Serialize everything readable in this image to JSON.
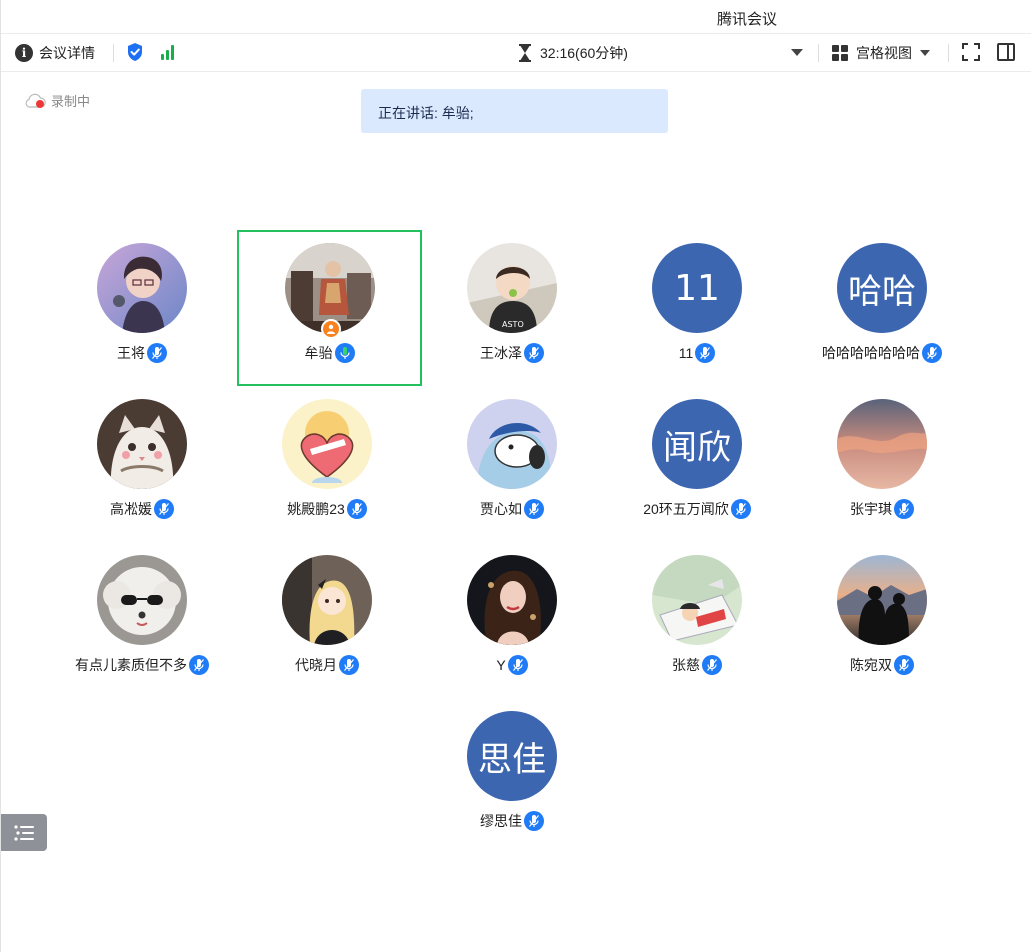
{
  "window": {
    "title": "腾讯会议"
  },
  "toolbar": {
    "meeting_info_label": "会议详情",
    "timer_text": "32:16(60分钟)",
    "view_label": "宫格视图"
  },
  "recording_label": "录制中",
  "speaking_banner": "正在讲话: 牟骀;",
  "colors": {
    "accent": "#3d66b1",
    "active_border": "#22c15e",
    "mic": "#1f7bf6",
    "banner": "#dbe9ff"
  },
  "participants": [
    {
      "name": "王将",
      "avatar": "photo-anime-boy",
      "muted": true
    },
    {
      "name": "牟骀",
      "avatar": "photo-child-old",
      "speaking": true,
      "host": true
    },
    {
      "name": "王冰泽",
      "avatar": "photo-baby",
      "muted": true
    },
    {
      "name": "11",
      "avatar_text": "11",
      "muted": true
    },
    {
      "name": "哈哈哈哈哈哈哈",
      "avatar_text": "哈哈",
      "muted": true
    },
    {
      "name": "高凇媛",
      "avatar": "photo-cat",
      "muted": true
    },
    {
      "name": "姚殿鹏23",
      "avatar": "photo-heart-cartoon",
      "muted": true
    },
    {
      "name": "贾心如",
      "avatar": "photo-puppy-cartoon",
      "muted": true
    },
    {
      "name": "20环五万闻欣",
      "avatar_text": "闻欣",
      "muted": true
    },
    {
      "name": "张宇琪",
      "avatar": "photo-sunset-sky",
      "muted": true
    },
    {
      "name": "有点儿素质但不多",
      "avatar": "photo-dog-sunglasses",
      "muted": true
    },
    {
      "name": "代晓月",
      "avatar": "photo-anime-girl",
      "muted": true
    },
    {
      "name": "Y",
      "avatar": "photo-woman",
      "muted": true
    },
    {
      "name": "张慈",
      "avatar": "photo-cartoon-sleeping",
      "muted": true
    },
    {
      "name": "陈宛双",
      "avatar": "photo-couple-mountain",
      "muted": true
    },
    {
      "name": "缪思佳",
      "avatar_text": "思佳",
      "muted": true
    }
  ]
}
